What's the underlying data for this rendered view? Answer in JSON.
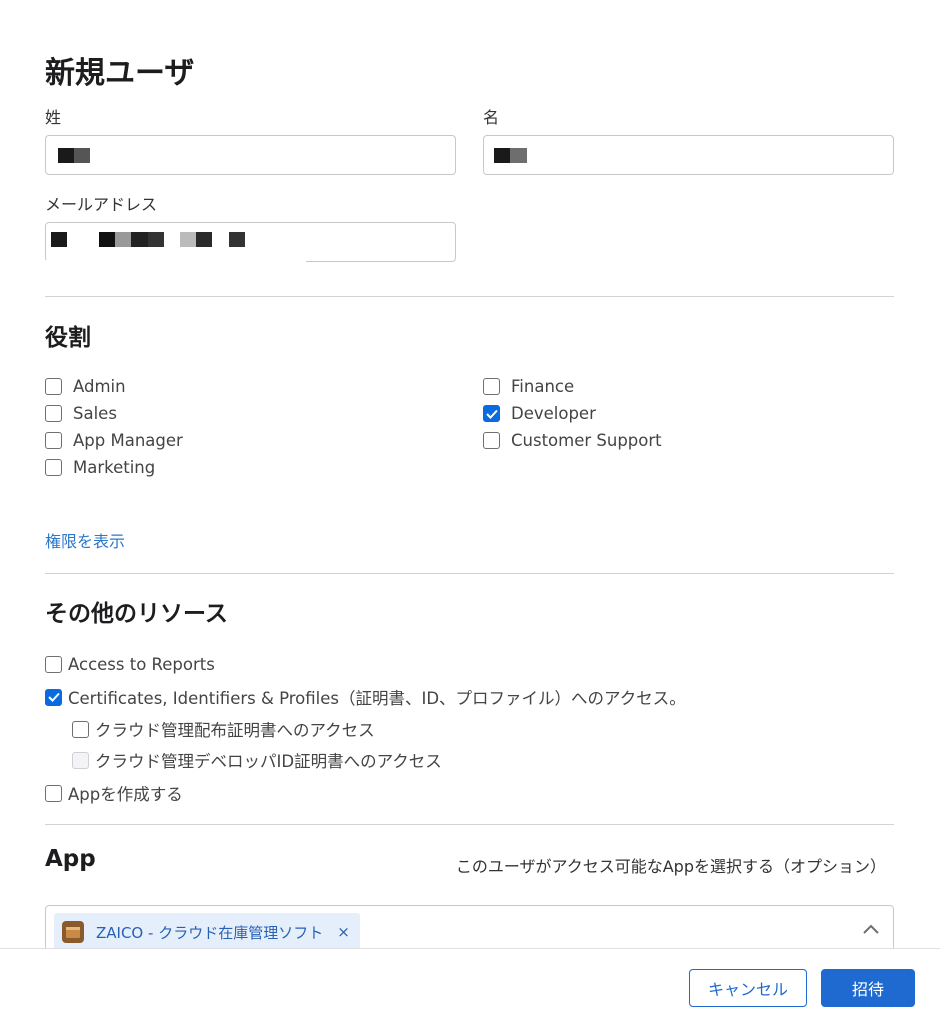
{
  "page": {
    "title": "新規ユーザ"
  },
  "form": {
    "last_name_label": "姓",
    "first_name_label": "名",
    "email_label": "メールアドレス"
  },
  "roles": {
    "title": "役割",
    "left": [
      {
        "label": "Admin",
        "checked": false
      },
      {
        "label": "Sales",
        "checked": false
      },
      {
        "label": "App Manager",
        "checked": false
      },
      {
        "label": "Marketing",
        "checked": false
      }
    ],
    "right": [
      {
        "label": "Finance",
        "checked": false
      },
      {
        "label": "Developer",
        "checked": true
      },
      {
        "label": "Customer Support",
        "checked": false
      }
    ],
    "show_permissions_link": "権限を表示"
  },
  "resources": {
    "title": "その他のリソース",
    "items": [
      {
        "label": "Access to Reports",
        "checked": false,
        "disabled": false
      },
      {
        "label": "Certificates, Identifiers & Profiles（証明書、ID、プロファイル）へのアクセス。",
        "checked": true,
        "disabled": false
      },
      {
        "label": "クラウド管理配布証明書へのアクセス",
        "checked": false,
        "disabled": false
      },
      {
        "label": "クラウド管理デベロッパID証明書へのアクセス",
        "checked": false,
        "disabled": true
      },
      {
        "label": "Appを作成する",
        "checked": false,
        "disabled": false
      }
    ]
  },
  "apps": {
    "title": "App",
    "hint": "このユーザがアクセス可能なAppを選択する（オプション）",
    "selected": [
      {
        "label": "ZAICO - クラウド在庫管理ソフト",
        "remove_glyph": "×",
        "icon": "box-icon"
      }
    ]
  },
  "footer": {
    "cancel_label": "キャンセル",
    "invite_label": "招待"
  },
  "colors": {
    "accent": "#1f6ad0",
    "link": "#2d77c9",
    "chip_bg": "#e5effc"
  }
}
